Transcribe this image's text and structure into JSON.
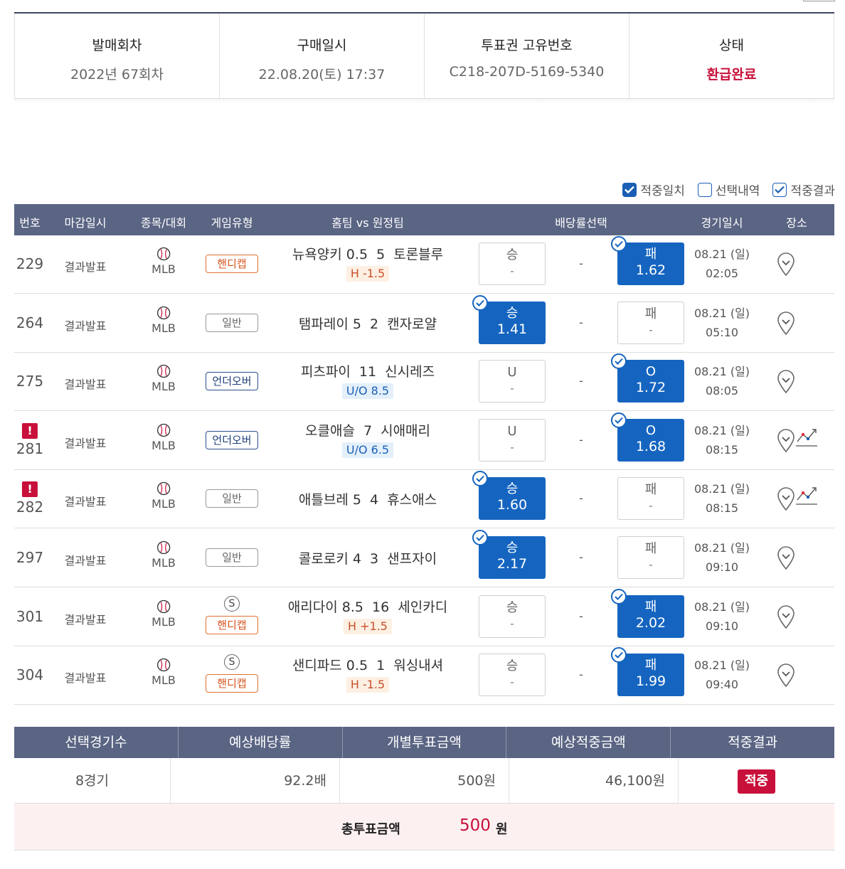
{
  "ticket": {
    "round_label": "발매회차",
    "round_value": "2022년 67회차",
    "purchase_label": "구매일시",
    "purchase_value": "22.08.20(토) 17:37",
    "id_label": "투표권 고유번호",
    "id_value": "C218-207D-5169-5340",
    "status_label": "상태",
    "status_value": "환급완료"
  },
  "legend": {
    "hit_match": "적중일치",
    "selection": "선택내역",
    "hit_result": "적중결과"
  },
  "columns": {
    "no": "번호",
    "deadline": "마감일시",
    "sport": "종목/대회",
    "game_type": "게임유형",
    "teams": "홈팀 vs 원정팀",
    "odds": "배당률선택",
    "game_date": "경기일시",
    "venue": "장소"
  },
  "rows": [
    {
      "no": "229",
      "deadline": "결과발표",
      "league": "MLB",
      "type": "핸디캡",
      "home": "뉴욕양키 0.5",
      "score": "5",
      "away": "토론블루",
      "sub": "H -1.5",
      "left_label": "승",
      "left_val": "-",
      "mid": "-",
      "right_label": "패",
      "right_val": "1.62",
      "date": "08.21 (일)",
      "time": "02:05"
    },
    {
      "no": "264",
      "deadline": "결과발표",
      "league": "MLB",
      "type": "일반",
      "home": "탬파레이 5",
      "score": "2",
      "away": "캔자로얄",
      "left_label": "승",
      "left_val": "1.41",
      "mid": "-",
      "right_label": "패",
      "right_val": "-",
      "date": "08.21 (일)",
      "time": "05:10"
    },
    {
      "no": "275",
      "deadline": "결과발표",
      "league": "MLB",
      "type": "언더오버",
      "home": "피츠파이",
      "score": "11",
      "away": "신시레즈",
      "sub": "U/O 8.5",
      "left_label": "U",
      "left_val": "-",
      "mid": "-",
      "right_label": "O",
      "right_val": "1.72",
      "date": "08.21 (일)",
      "time": "08:05"
    },
    {
      "no": "281",
      "alert": "!",
      "deadline": "결과발표",
      "league": "MLB",
      "type": "언더오버",
      "home": "오클애슬",
      "score": "7",
      "away": "시애매리",
      "sub": "U/O 6.5",
      "left_label": "U",
      "left_val": "-",
      "mid": "-",
      "right_label": "O",
      "right_val": "1.68",
      "date": "08.21 (일)",
      "time": "08:15"
    },
    {
      "no": "282",
      "alert": "!",
      "deadline": "결과발표",
      "league": "MLB",
      "type": "일반",
      "home": "애틀브레 5",
      "score": "4",
      "away": "휴스애스",
      "left_label": "승",
      "left_val": "1.60",
      "mid": "-",
      "right_label": "패",
      "right_val": "-",
      "date": "08.21 (일)",
      "time": "08:15"
    },
    {
      "no": "297",
      "deadline": "결과발표",
      "league": "MLB",
      "type": "일반",
      "home": "콜로로키 4",
      "score": "3",
      "away": "샌프자이",
      "left_label": "승",
      "left_val": "2.17",
      "mid": "-",
      "right_label": "패",
      "right_val": "-",
      "date": "08.21 (일)",
      "time": "09:10"
    },
    {
      "no": "301",
      "deadline": "결과발표",
      "league": "MLB",
      "special": "S",
      "type": "핸디캡",
      "home": "애리다이 8.5",
      "score": "16",
      "away": "세인카디",
      "sub": "H +1.5",
      "left_label": "승",
      "left_val": "-",
      "mid": "-",
      "right_label": "패",
      "right_val": "2.02",
      "date": "08.21 (일)",
      "time": "09:10"
    },
    {
      "no": "304",
      "deadline": "결과발표",
      "league": "MLB",
      "special": "S",
      "type": "핸디캡",
      "home": "샌디파드 0.5",
      "score": "1",
      "away": "워싱내셔",
      "sub": "H -1.5",
      "left_label": "승",
      "left_val": "-",
      "mid": "-",
      "right_label": "패",
      "right_val": "1.99",
      "date": "08.21 (일)",
      "time": "09:40"
    }
  ],
  "summary": {
    "h1": "선택경기수",
    "h2": "예상배당률",
    "h3": "개별투표금액",
    "h4": "예상적중금액",
    "h5": "적중결과",
    "games": "8경기",
    "odds": "92.2배",
    "stake": "500원",
    "payout": "46,100원",
    "result": "적중",
    "total_label": "총투표금액",
    "total_value": "500",
    "total_unit": "원"
  },
  "colors": {
    "header_bg": "#5a6483",
    "accent_blue": "#1565c0",
    "accent_red": "#c8103a"
  }
}
